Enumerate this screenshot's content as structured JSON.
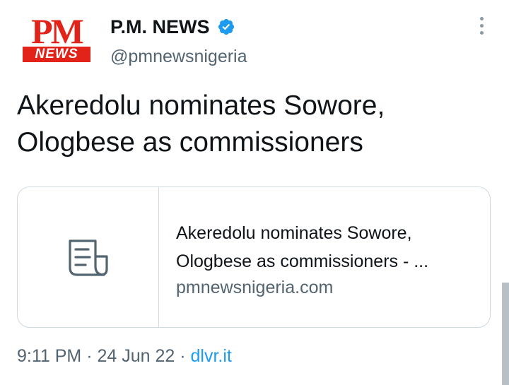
{
  "header": {
    "avatar_logo": {
      "pm": "PM",
      "news": "NEWS"
    },
    "display_name": "P.M. NEWS",
    "verified": true,
    "handle": "@pmnewsnigeria",
    "more_icon": "vertical-ellipsis-icon"
  },
  "tweet": {
    "line1": "Akeredolu nominates Sowore,",
    "line2": "Ologbese as commissioners"
  },
  "link_card": {
    "thumb_icon": "document-icon",
    "title_line1": "Akeredolu nominates Sowore,",
    "title_line2": "Ologbese as commissioners - ...",
    "domain": "pmnewsnigeria.com"
  },
  "meta": {
    "time": "9:11 PM",
    "sep1": " · ",
    "date": "24 Jun 22",
    "sep2": " · ",
    "source": "dlvr.it"
  },
  "colors": {
    "brand_red": "#e2231a",
    "verified_blue": "#1d9bf0",
    "secondary_text": "#536471"
  }
}
